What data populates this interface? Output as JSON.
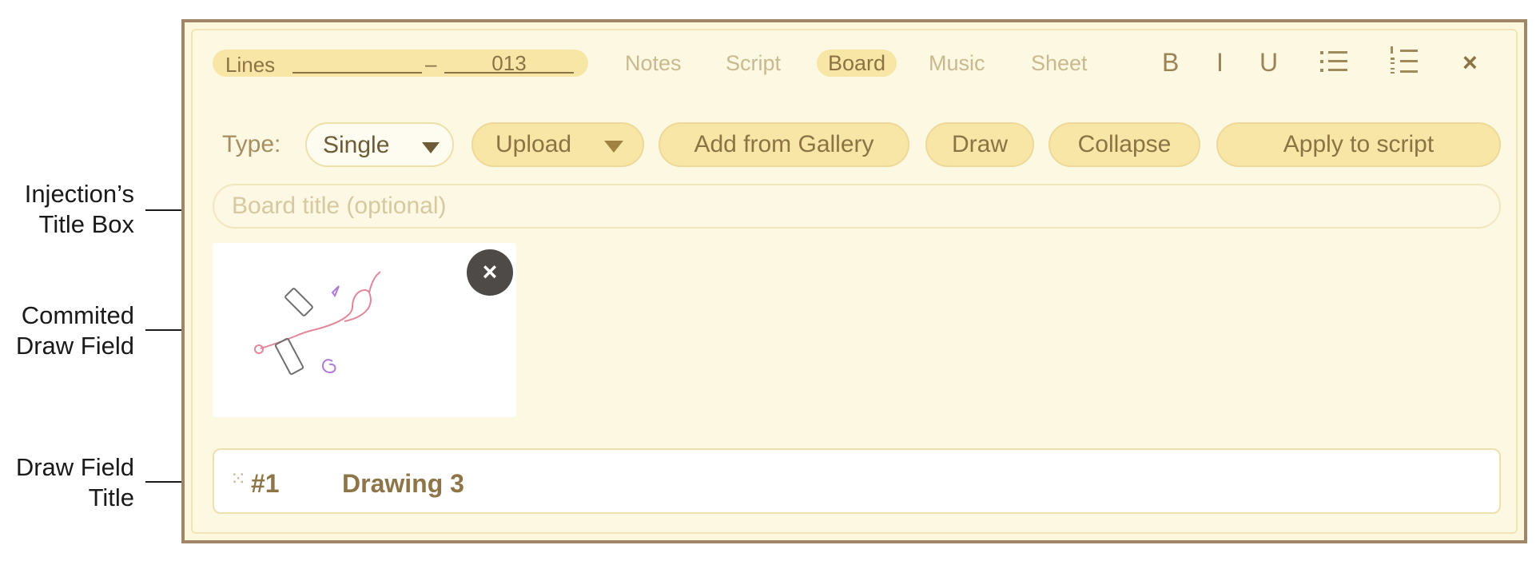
{
  "annotations": {
    "title_box": [
      "Injection’s",
      "Title Box"
    ],
    "draw_field": [
      "Commited",
      "Draw Field"
    ],
    "draw_field_title": [
      "Draw Field",
      "Title"
    ]
  },
  "header": {
    "lines_label": "Lines",
    "line_start": "",
    "line_separator": "–",
    "line_end": "013",
    "tabs": [
      "Notes",
      "Script",
      "Board",
      "Music",
      "Sheet"
    ],
    "active_tab": "Board",
    "format_buttons": {
      "bold": "B",
      "italic": "I",
      "underline": "U"
    },
    "close_glyph": "×"
  },
  "toolbar": {
    "type_label": "Type:",
    "type_value": "Single",
    "upload_label": "Upload",
    "gallery_label": "Add from Gallery",
    "draw_label": "Draw",
    "collapse_label": "Collapse",
    "apply_label": "Apply to script"
  },
  "board": {
    "title_placeholder": "Board title (optional)",
    "title_value": ""
  },
  "drawing": {
    "remove_glyph": "×",
    "number": "#1",
    "title": "Drawing 3",
    "grip_glyph": "⁙"
  },
  "colors": {
    "frame": "#9e8766",
    "panel": "#fdf8e1",
    "pill": "#f7e6a6",
    "text_brown": "#8b7344",
    "sketch_red": "#e2879a",
    "sketch_purple": "#b07ad8"
  }
}
